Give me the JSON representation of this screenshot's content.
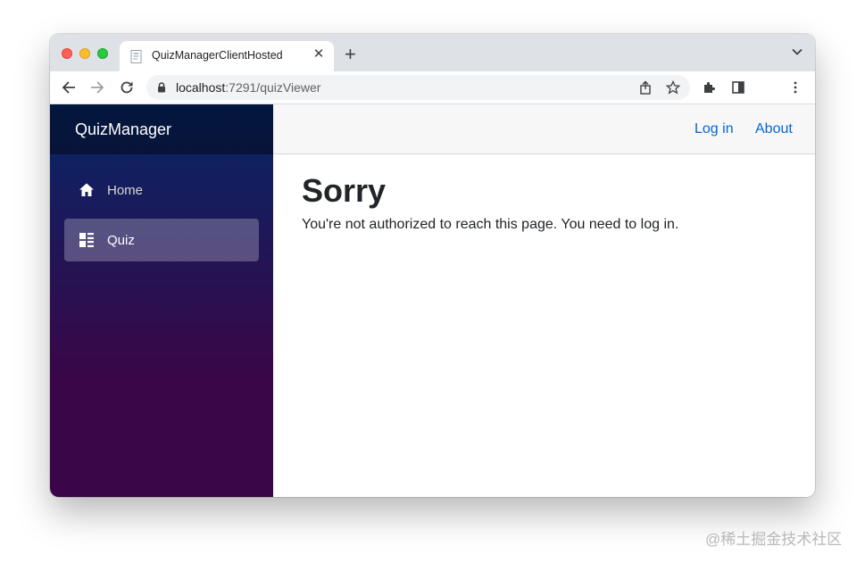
{
  "browser": {
    "tab_title": "QuizManagerClientHosted",
    "url_host": "localhost",
    "url_path": ":7291/quizViewer"
  },
  "app": {
    "brand": "QuizManager",
    "nav": [
      {
        "label": "Home",
        "icon": "home-icon",
        "active": false
      },
      {
        "label": "Quiz",
        "icon": "list-icon",
        "active": true
      }
    ],
    "top_links": {
      "login": "Log in",
      "about": "About"
    },
    "page_title": "Sorry",
    "message": "You're not authorized to reach this page. You need to log in.",
    "colors": {
      "link": "#0366d6",
      "sidebar_top": "#052767",
      "sidebar_bottom": "#3a0647"
    }
  },
  "watermark": "@稀土掘金技术社区"
}
